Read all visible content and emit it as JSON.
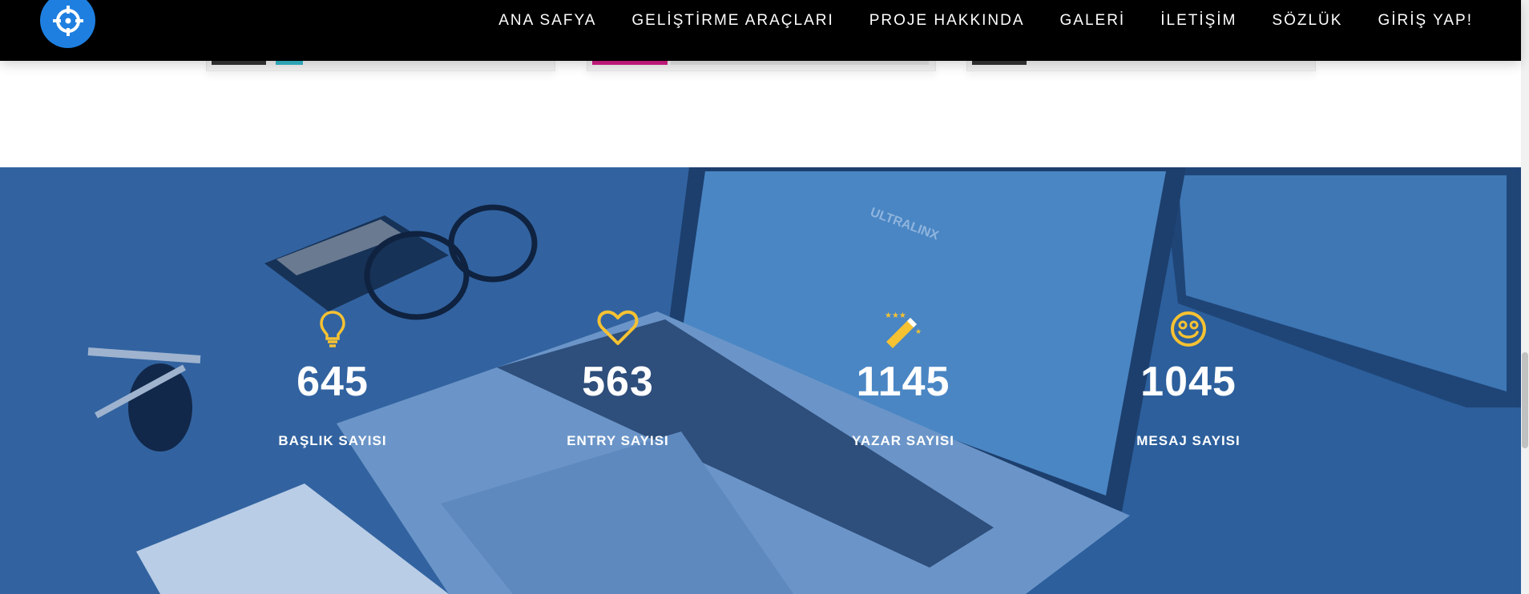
{
  "nav": {
    "items": [
      {
        "label": "ANA SAFYA"
      },
      {
        "label": "GELİŞTİRME ARAÇLARI"
      },
      {
        "label": "PROJE HAKKINDA"
      },
      {
        "label": "GALERİ"
      },
      {
        "label": "İLETİŞİM"
      },
      {
        "label": "SÖZLÜK"
      },
      {
        "label": "GİRİŞ YAP!"
      }
    ]
  },
  "stats": [
    {
      "icon": "lightbulb-icon",
      "value": "645",
      "label": "BAŞLIK SAYISI"
    },
    {
      "icon": "heart-icon",
      "value": "563",
      "label": "ENTRY SAYISI"
    },
    {
      "icon": "magic-wand-icon",
      "value": "1145",
      "label": "YAZAR SAYISI"
    },
    {
      "icon": "smiley-icon",
      "value": "1045",
      "label": "MESAJ SAYISI"
    }
  ],
  "colors": {
    "nav_bg": "#000000",
    "logo_blue": "#1e7fe0",
    "overlay_blue": "#2c5f9c",
    "icon_yellow": "#f6c232",
    "text_white": "#ffffff"
  }
}
